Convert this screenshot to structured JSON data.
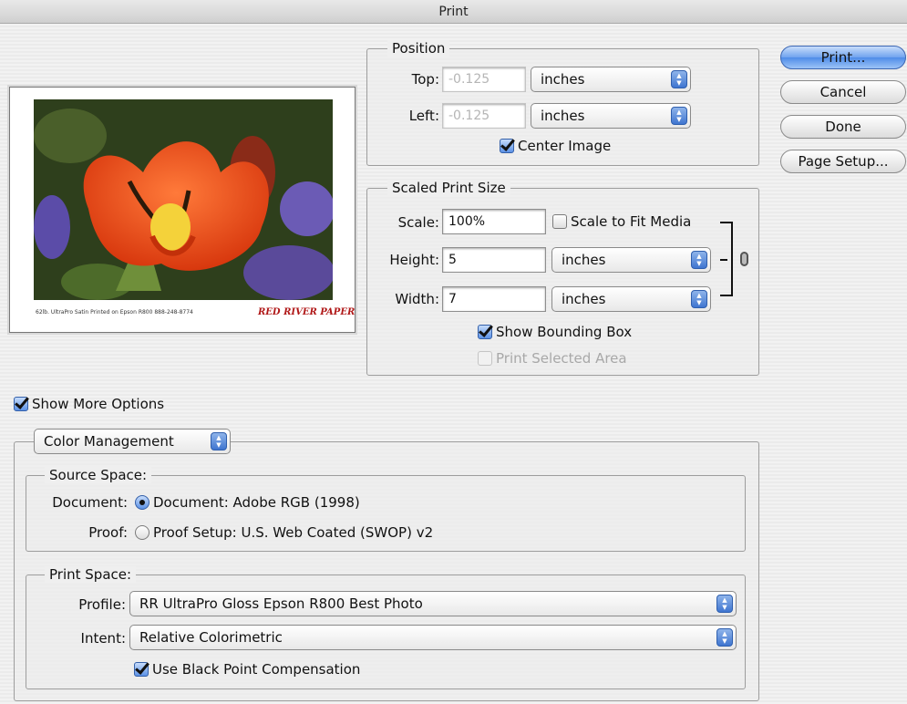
{
  "window": {
    "title": "Print"
  },
  "buttons": {
    "print": "Print...",
    "cancel": "Cancel",
    "done": "Done",
    "page_setup": "Page Setup..."
  },
  "preview": {
    "caption": "62lb. UltraPro Satin   Printed on Epson R800  888-248-8774",
    "brand": "RED RIVER PAPER"
  },
  "position": {
    "legend": "Position",
    "top_label": "Top:",
    "top_value": "-0.125",
    "top_unit": "inches",
    "left_label": "Left:",
    "left_value": "-0.125",
    "left_unit": "inches",
    "center_image": "Center Image",
    "center_image_checked": true
  },
  "scaled": {
    "legend": "Scaled Print Size",
    "scale_label": "Scale:",
    "scale_value": "100%",
    "scale_to_fit": "Scale to Fit Media",
    "scale_to_fit_checked": false,
    "height_label": "Height:",
    "height_value": "5",
    "height_unit": "inches",
    "width_label": "Width:",
    "width_value": "7",
    "width_unit": "inches",
    "show_bounding_box": "Show Bounding Box",
    "show_bounding_box_checked": true,
    "print_selected_area": "Print Selected Area",
    "print_selected_area_enabled": false
  },
  "more_options": {
    "label": "Show More Options",
    "checked": true
  },
  "color_management": {
    "popup": "Color Management",
    "source_space": {
      "legend": "Source Space:",
      "document_label": "Document:",
      "document_option": "Document:  Adobe RGB (1998)",
      "proof_label": "Proof:",
      "proof_option": "Proof Setup:  U.S. Web Coated (SWOP) v2",
      "selected": "document"
    },
    "print_space": {
      "legend": "Print Space:",
      "profile_label": "Profile:",
      "profile_value": "RR UltraPro Gloss Epson R800 Best Photo",
      "intent_label": "Intent:",
      "intent_value": "Relative Colorimetric",
      "bpc_label": "Use Black Point Compensation",
      "bpc_checked": true
    }
  },
  "icons": {
    "stepper": "popup-stepper-icon",
    "chain": "constrain-proportions-link-icon"
  }
}
